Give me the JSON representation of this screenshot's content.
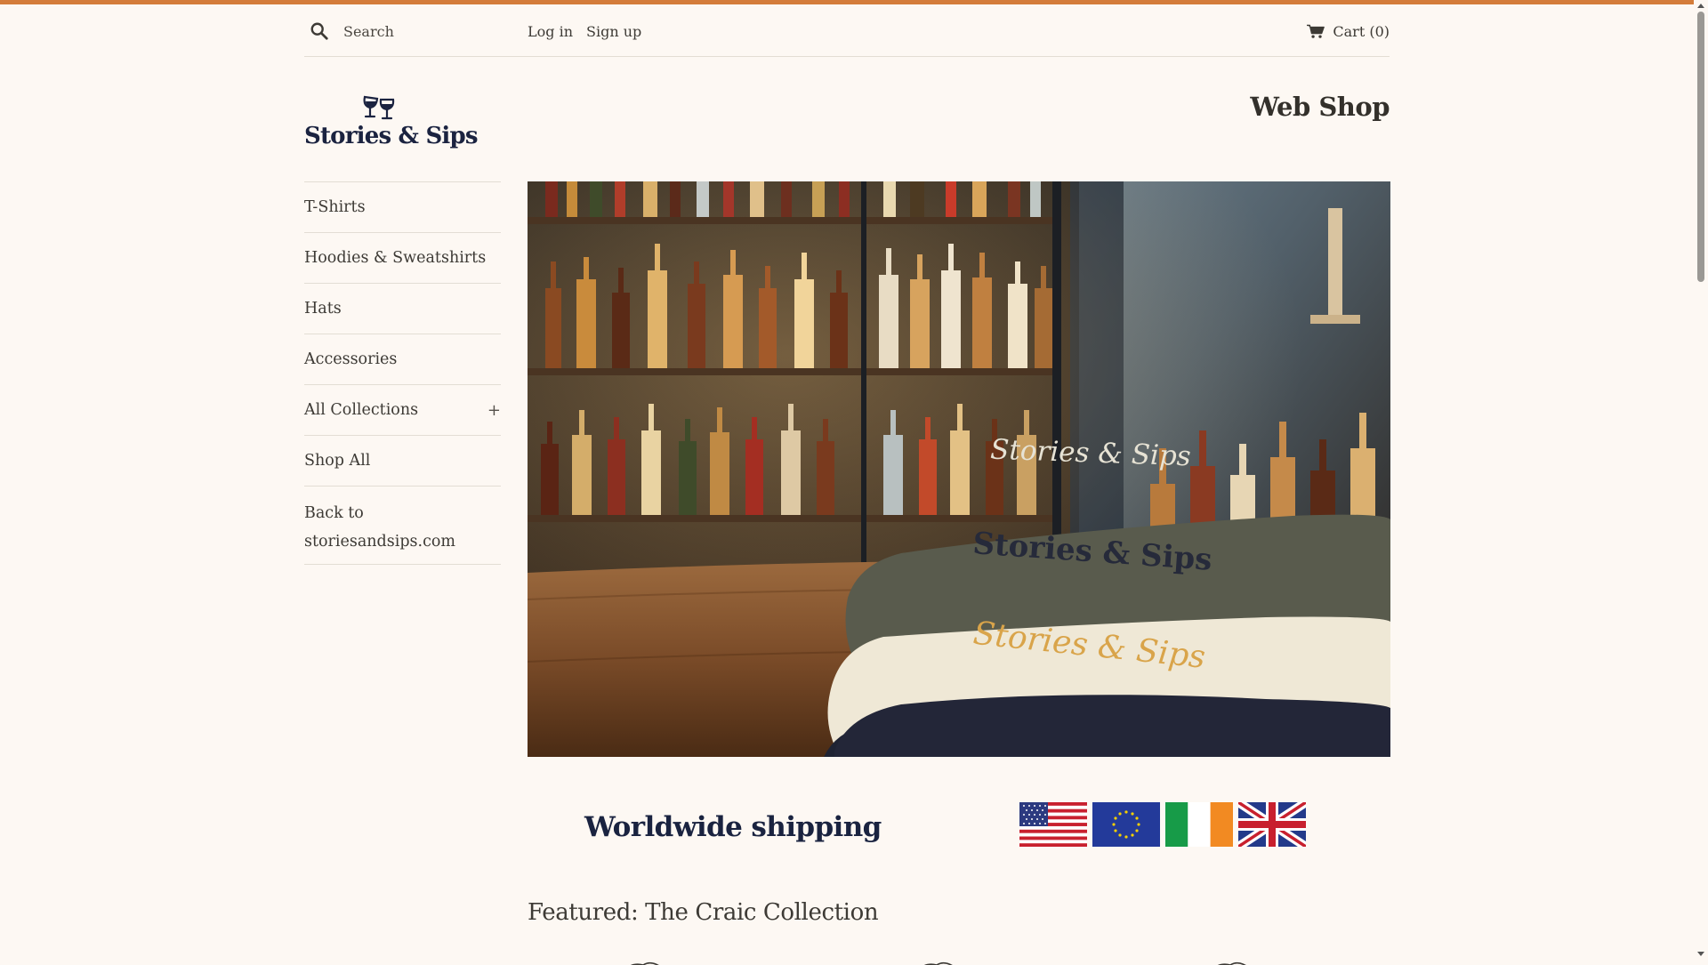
{
  "colors": {
    "accent": "#d47c3a",
    "text": "#3d3a35",
    "navy": "#1b2340",
    "background": "#fdf8f3"
  },
  "header": {
    "search_placeholder": "Search",
    "login_label": "Log in",
    "signup_label": "Sign up",
    "cart_label": "Cart (0)"
  },
  "logo": {
    "text": "Stories & Sips",
    "icon": "wine-glasses-icon"
  },
  "site_title": "Web Shop",
  "sidebar": {
    "items": [
      {
        "label": "T-Shirts"
      },
      {
        "label": "Hoodies & Sweatshirts"
      },
      {
        "label": "Hats"
      },
      {
        "label": "Accessories"
      },
      {
        "label": "All Collections",
        "expand_icon": "+"
      },
      {
        "label": "Shop All"
      },
      {
        "label": "Back to storiesandsips.com"
      }
    ]
  },
  "hero": {
    "sweatshirt_texts": [
      "Stories & Sips",
      "Stories & Sips",
      "Stories & Sips"
    ]
  },
  "shipping": {
    "text": "Worldwide shipping",
    "flags": [
      "us-flag-icon",
      "eu-flag-icon",
      "ireland-flag-icon",
      "uk-flag-icon"
    ]
  },
  "featured": {
    "heading": "Featured: The Craic Collection"
  }
}
